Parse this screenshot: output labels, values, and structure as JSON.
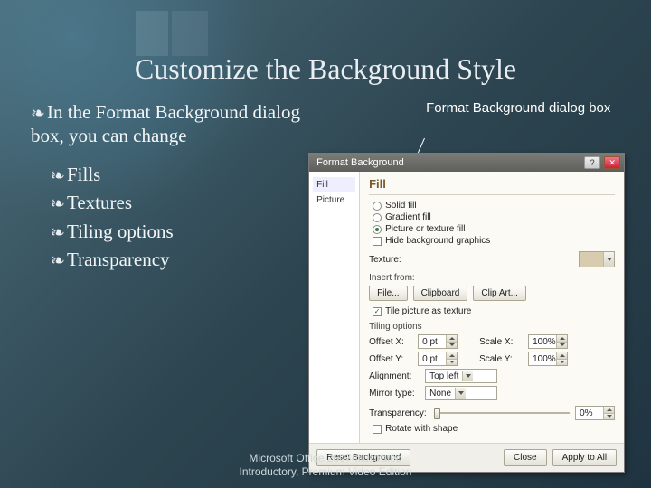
{
  "slide": {
    "title": "Customize the Background Style",
    "main_bullet": "In the Format Background dialog box, you can change",
    "sub_bullets": [
      "Fills",
      "Textures",
      "Tiling options",
      "Transparency"
    ],
    "callout": "Format Background dialog box",
    "footer1": "Microsoft Office 2007-Illustrated",
    "footer2": "Introductory, Premium Video Edition"
  },
  "dialog": {
    "title": "Format Background",
    "nav": {
      "item1": "Fill",
      "item2": "Picture"
    },
    "section": "Fill",
    "radios": {
      "solid": "Solid fill",
      "gradient": "Gradient fill",
      "picture": "Picture or texture fill"
    },
    "hide_bg": "Hide background graphics",
    "texture_lbl": "Texture:",
    "insert_from": "Insert from:",
    "btn_file": "File...",
    "btn_clipboard": "Clipboard",
    "btn_clipart": "Clip Art...",
    "tile_chk": "Tile picture as texture",
    "tiling_lbl": "Tiling options",
    "offx": "Offset X:",
    "offy": "Offset Y:",
    "scalex": "Scale X:",
    "scaley": "Scale Y:",
    "offx_v": "0 pt",
    "offy_v": "0 pt",
    "scalex_v": "100%",
    "scaley_v": "100%",
    "align": "Alignment:",
    "align_v": "Top left",
    "mirror": "Mirror type:",
    "mirror_v": "None",
    "transparency": "Transparency:",
    "transparency_v": "0%",
    "rotate": "Rotate with shape",
    "btn_reset": "Reset Background",
    "btn_close": "Close",
    "btn_apply": "Apply to All"
  }
}
